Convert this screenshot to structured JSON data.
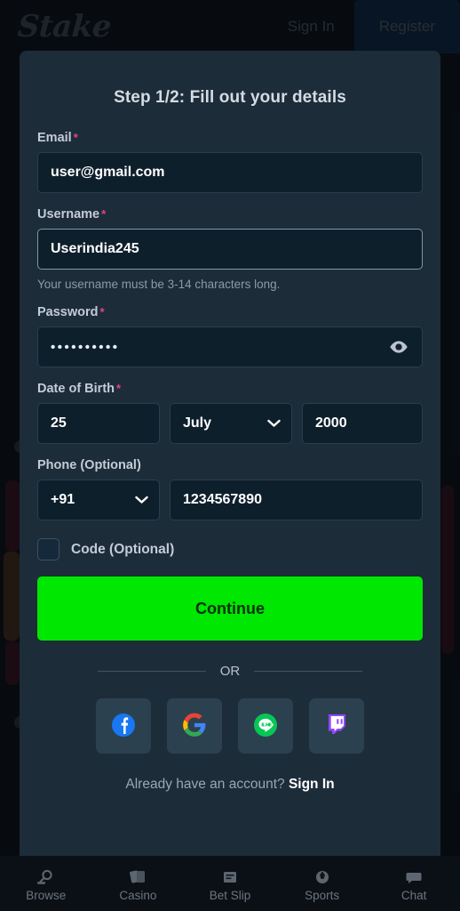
{
  "topbar": {
    "logo_text": "Stake",
    "nav": [
      {
        "label": "Sign In",
        "active": false
      },
      {
        "label": "Register",
        "active": true
      }
    ]
  },
  "modal": {
    "title": "Step 1/2: Fill out your details",
    "email": {
      "label": "Email",
      "required_mark": "*",
      "value": "user@gmail.com"
    },
    "username": {
      "label": "Username",
      "required_mark": "*",
      "value": "Userindia245",
      "hint": "Your username must be 3-14 characters long."
    },
    "password": {
      "label": "Password",
      "required_mark": "*",
      "value": "••••••••••",
      "toggle_icon": "eye-icon"
    },
    "dob": {
      "label": "Date of Birth",
      "required_mark": "*",
      "day": "25",
      "month": "July",
      "year": "2000",
      "month_chevron_icon": "chevron-down-icon"
    },
    "phone": {
      "label": "Phone (Optional)",
      "country_code": "+91",
      "number": "1234567890",
      "cc_chevron_icon": "chevron-down-icon"
    },
    "code_checkbox": {
      "label": "Code (Optional)",
      "checked": false
    },
    "continue_button": {
      "label": "Continue",
      "color": "#00e701"
    },
    "divider_text": "OR",
    "socials": [
      {
        "name": "facebook",
        "color": "#1877f2"
      },
      {
        "name": "google",
        "color": "#ea4335"
      },
      {
        "name": "line",
        "color": "#06c755"
      },
      {
        "name": "twitch",
        "color": "#9146ff"
      }
    ],
    "footer": {
      "text": "Already have an account?",
      "link": "Sign In"
    }
  },
  "bottomnav": [
    {
      "label": "Browse",
      "icon": "search-icon"
    },
    {
      "label": "Casino",
      "icon": "cards-icon"
    },
    {
      "label": "Bet Slip",
      "icon": "betslip-icon"
    },
    {
      "label": "Sports",
      "icon": "sports-icon"
    },
    {
      "label": "Chat",
      "icon": "chat-icon"
    }
  ]
}
